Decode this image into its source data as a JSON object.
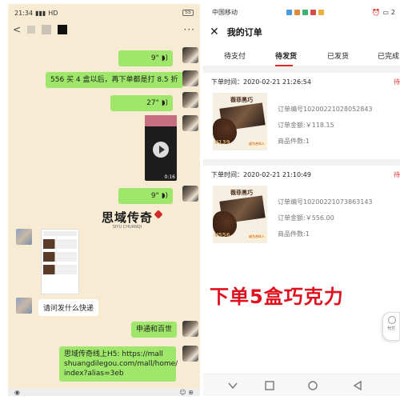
{
  "left_chat": {
    "status_time": "21:34",
    "status_network": "HD",
    "battery": "55",
    "back_icon": "<",
    "more_icon": "···",
    "messages": [
      {
        "type": "voice",
        "duration": "9\""
      },
      {
        "type": "text",
        "text": "556 买 4 盒以后，再下单都是打 8.5 折"
      },
      {
        "type": "voice",
        "duration": "27\""
      },
      {
        "type": "video",
        "duration": "0:16"
      },
      {
        "type": "voice",
        "duration": "9\""
      },
      {
        "type": "text_in",
        "text": "请问发什么快递"
      },
      {
        "type": "text",
        "text": "申通和百世"
      },
      {
        "type": "text",
        "lines": [
          "思域传奇线上H5: https://mall",
          "shuangdilegou.com/mall/home/",
          "index?alias=3eb"
        ]
      }
    ],
    "logo_text": "思域传奇",
    "logo_subtext": "SIYU CHUANQI"
  },
  "right_orders": {
    "status_carrier": "中国移动",
    "status_time": "2",
    "header_title": "我的订单",
    "close_icon": "✕",
    "tabs": [
      "待支付",
      "待发货",
      "已发货",
      "已完成"
    ],
    "active_tab": 1,
    "orders": [
      {
        "time_label": "下单时间：2020-02-21 21:26:54",
        "status_mark": "待",
        "order_no": "订单编号10200221028052843",
        "amount": "订单金额:￥118.15",
        "count": "商品件数:1",
        "product_name": "薇菲黑巧",
        "price_tag": "¥139",
        "promo_tag": "成为合伙人"
      },
      {
        "time_label": "下单时间：2020-02-21 21:10:49",
        "status_mark": "待",
        "order_no": "订单编号10200221073863143",
        "amount": "订单金额:￥556.00",
        "count": "商品件数:1",
        "product_name": "薇菲黑巧",
        "price_tag": "¥556",
        "promo_tag": "成为合伙人"
      }
    ],
    "big_note": "下单5盒巧克力",
    "side_float_label": "代付"
  },
  "colors": {
    "chat_bg": "#f7ecd3",
    "bubble_green": "#9ee76a",
    "accent_red": "#e12a2a",
    "note_red": "#e0101e"
  }
}
